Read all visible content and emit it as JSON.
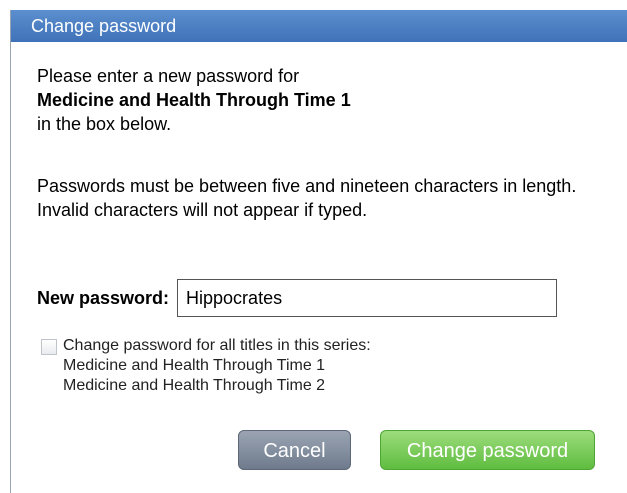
{
  "dialog": {
    "title": "Change password",
    "intro_line1": "Please enter a new password for",
    "book_title": "Medicine and Health Through Time 1",
    "intro_line3": "in the box below.",
    "rules_text": "Passwords must be between five and nineteen characters in length.  Invalid characters will not appear if typed.",
    "password_label": "New password:",
    "password_value": "Hippocrates",
    "series_checkbox": {
      "checked": false,
      "label": "Change password for all titles in this series:",
      "titles": [
        "Medicine and Health Through Time 1",
        "Medicine and Health Through Time 2"
      ]
    },
    "cancel_label": "Cancel",
    "change_label": "Change password"
  },
  "colors": {
    "titlebar": "#4a7fc3",
    "cancel_button": "#7f8a9b",
    "change_button": "#72c84f"
  }
}
